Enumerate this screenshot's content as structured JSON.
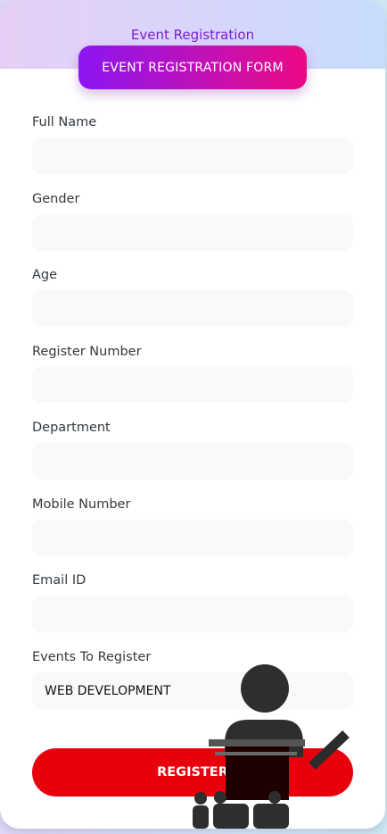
{
  "header": {
    "title": "Event Registration",
    "form_badge": "EVENT REGISTRATION FORM"
  },
  "fields": [
    {
      "label": "Full Name",
      "value": ""
    },
    {
      "label": "Gender",
      "value": ""
    },
    {
      "label": "Age",
      "value": ""
    },
    {
      "label": "Register Number",
      "value": ""
    },
    {
      "label": "Department",
      "value": ""
    },
    {
      "label": "Mobile Number",
      "value": ""
    },
    {
      "label": "Email ID",
      "value": ""
    },
    {
      "label": "Events To Register",
      "value": "WEB DEVELOPMENT"
    }
  ],
  "register_button": "REGISTER",
  "colors": {
    "accent_purple": "#8b15f2",
    "accent_pink": "#ec0a83",
    "register_red": "#e8000d",
    "header_text": "#7b1fd6"
  },
  "icons": {
    "illustration": "speaker-at-podium-icon"
  }
}
